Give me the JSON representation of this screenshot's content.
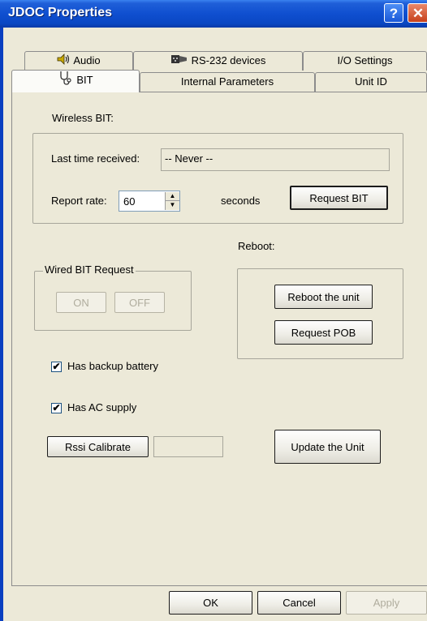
{
  "window": {
    "title": "JDOC Properties",
    "help_glyph": "?",
    "close_glyph": "✕"
  },
  "tabs_row1": [
    {
      "label": "Audio",
      "icon": "speaker-icon"
    },
    {
      "label": "RS-232 devices",
      "icon": "serial-connector-icon"
    },
    {
      "label": "I/O Settings"
    }
  ],
  "tabs_row2": [
    {
      "label": "BIT",
      "icon": "stethoscope-icon",
      "selected": true
    },
    {
      "label": "Internal Parameters"
    },
    {
      "label": "Unit ID"
    }
  ],
  "wireless": {
    "title": "Wireless BIT:",
    "last_time_label": "Last time received:",
    "last_time_value": "-- Never --",
    "report_rate_label": "Report rate:",
    "report_rate_value": "60",
    "seconds_label": "seconds",
    "request_bit_label": "Request BIT"
  },
  "reboot": {
    "title": "Reboot:",
    "reboot_label": "Reboot the unit",
    "request_pob_label": "Request POB"
  },
  "wired": {
    "title": "Wired BIT Request",
    "on_label": "ON",
    "off_label": "OFF"
  },
  "options": {
    "backup_battery_label": "Has backup battery",
    "backup_battery_checked": true,
    "ac_supply_label": "Has AC supply",
    "ac_supply_checked": true
  },
  "rssi": {
    "button_label": "Rssi Calibrate",
    "value": ""
  },
  "update_label": "Update the Unit",
  "footer": {
    "ok_label": "OK",
    "cancel_label": "Cancel",
    "apply_label": "Apply"
  }
}
